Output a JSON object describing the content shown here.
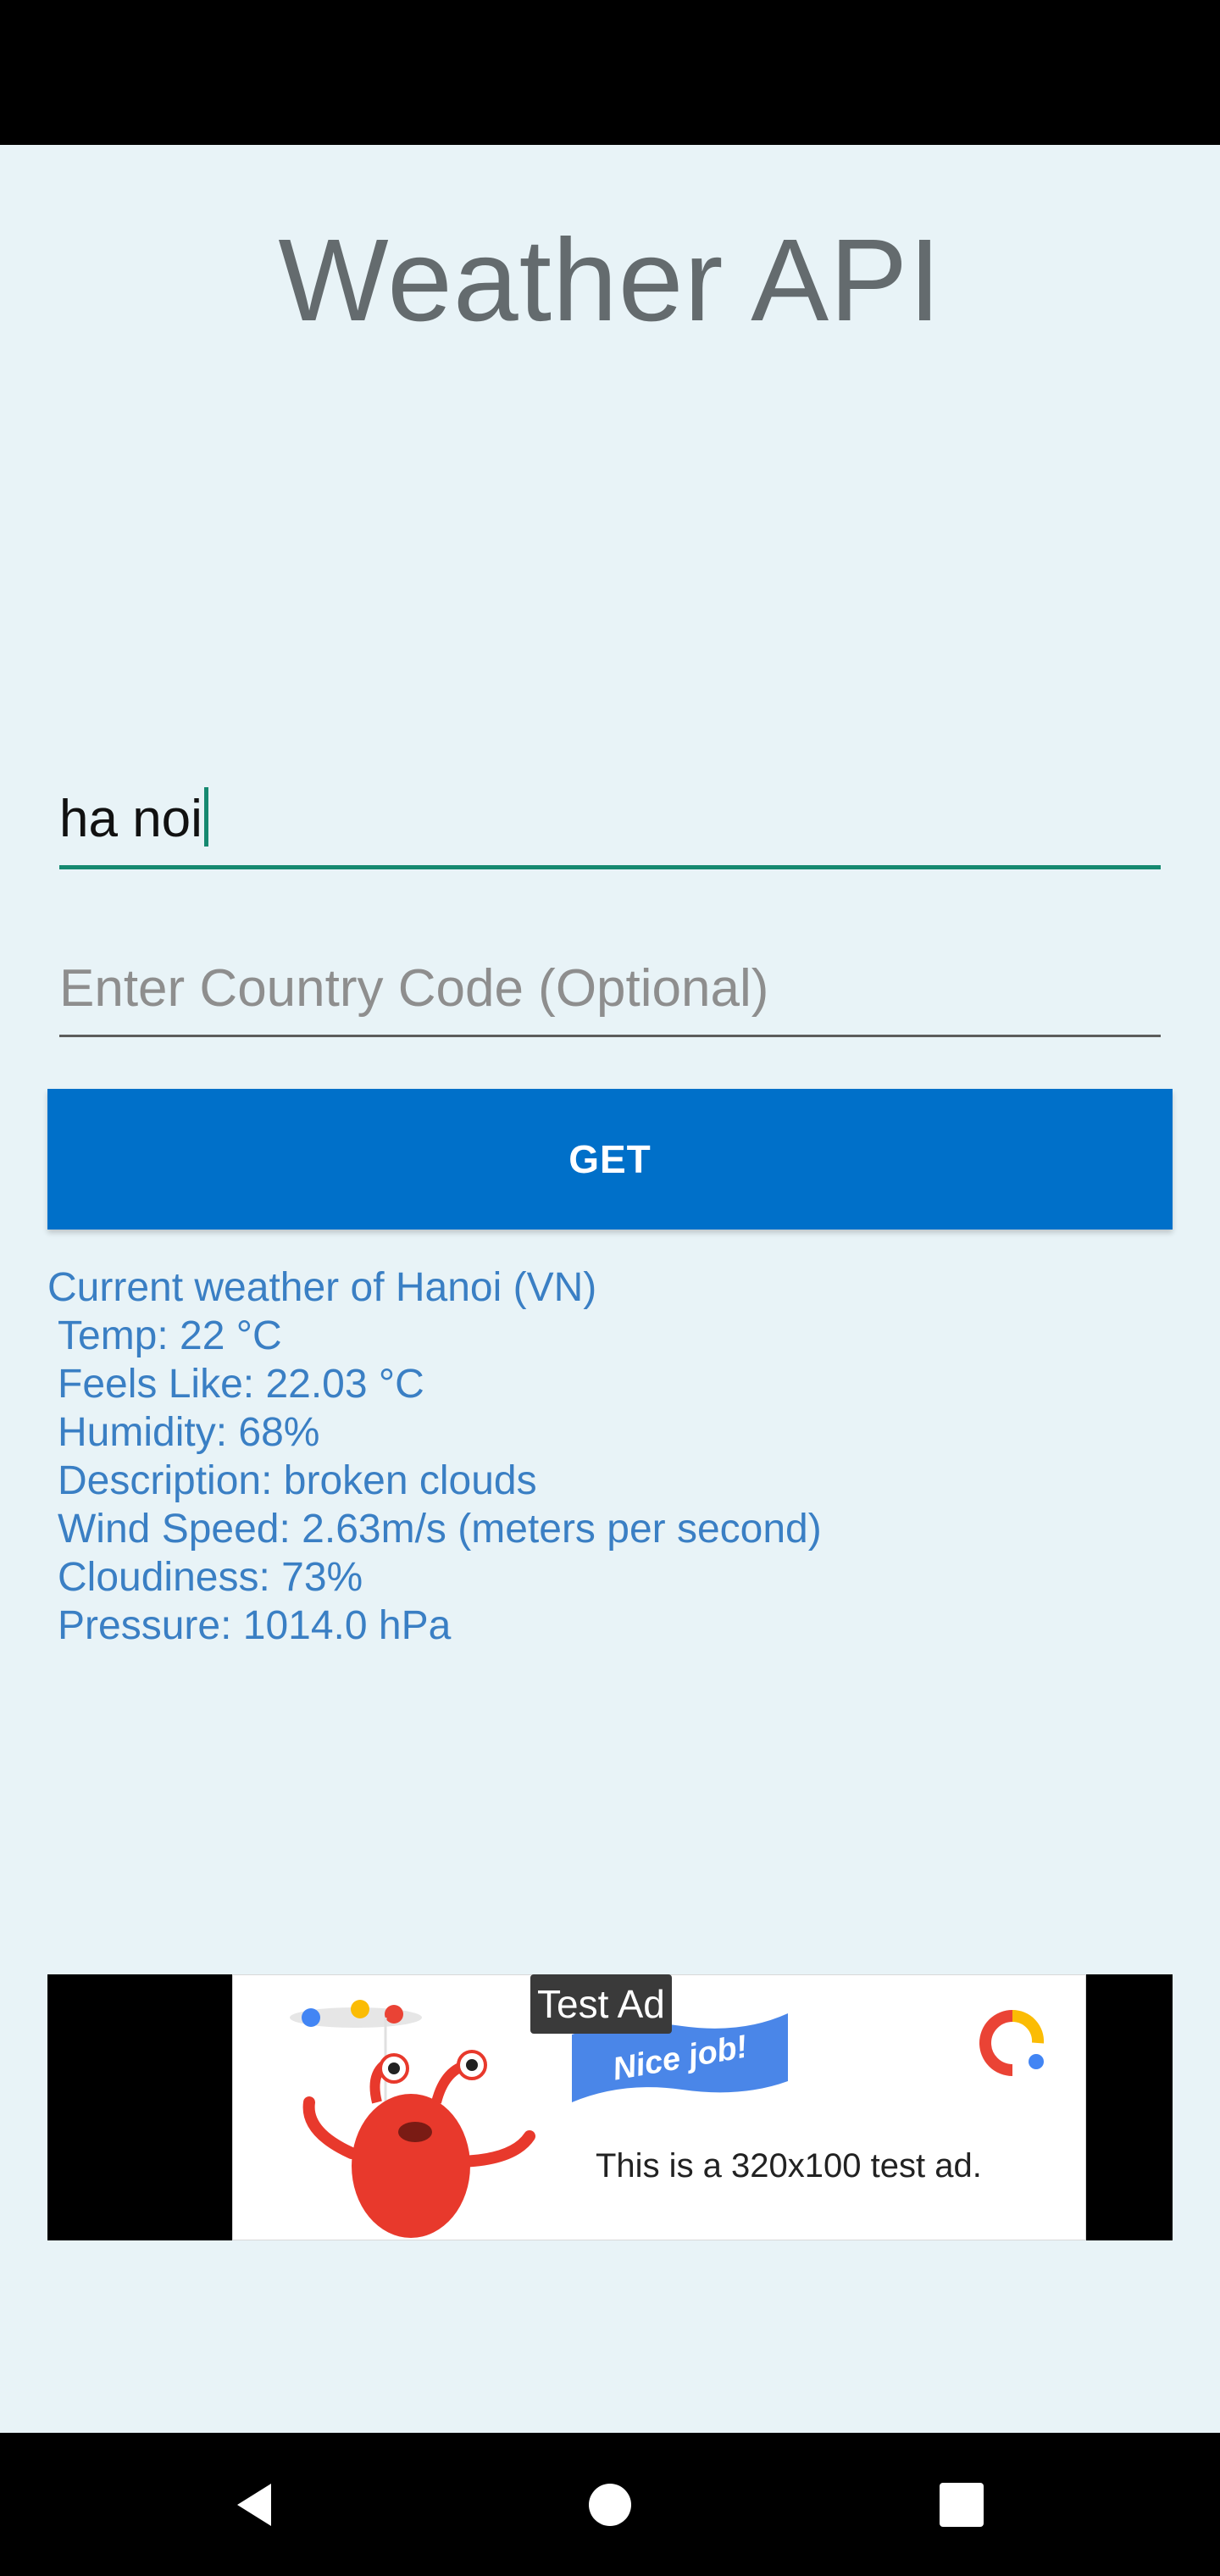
{
  "app": {
    "title": "Weather API"
  },
  "inputs": {
    "city_value": "ha noi",
    "country_placeholder": "Enter Country Code (Optional)"
  },
  "actions": {
    "get_label": "GET"
  },
  "result": {
    "heading": "Current weather of Hanoi (VN)",
    "temp": "Temp: 22 °C",
    "feels_like": "Feels Like: 22.03 °C",
    "humidity": "Humidity: 68%",
    "description": "Description: broken clouds",
    "wind_speed": "Wind Speed: 2.63m/s (meters per second)",
    "cloudiness": "Cloudiness: 73%",
    "pressure": "Pressure: 1014.0 hPa"
  },
  "ad": {
    "label": "Test Ad",
    "flag_text": "Nice job!",
    "text": "This is a 320x100 test ad.",
    "mascot_icon": "red-monster-mascot-icon",
    "logo_icon": "google-ads-logo-icon"
  },
  "navigation": {
    "back_icon": "triangle-back-icon",
    "home_icon": "circle-home-icon",
    "recents_icon": "square-recents-icon"
  },
  "colors": {
    "background": "#e8f3f7",
    "accent": "#158970",
    "button": "#0070c9",
    "result_text": "#3a7fc4",
    "title_text": "#646b6e"
  }
}
